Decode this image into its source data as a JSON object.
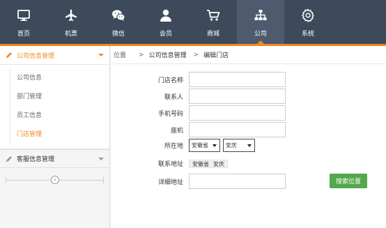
{
  "nav": {
    "items": [
      {
        "label": "首页",
        "icon": "monitor-icon"
      },
      {
        "label": "机票",
        "icon": "airplane-icon"
      },
      {
        "label": "微信",
        "icon": "wechat-icon"
      },
      {
        "label": "会员",
        "icon": "user-icon"
      },
      {
        "label": "商城",
        "icon": "cart-icon"
      },
      {
        "label": "公司",
        "icon": "org-chart-icon"
      },
      {
        "label": "系统",
        "icon": "gear-icon"
      }
    ],
    "active_index": 5,
    "accent_color": "#f08a1c",
    "bar_color": "#3d4a5c"
  },
  "sidebar": {
    "groups": [
      {
        "label": "公司信息管理",
        "expanded": true,
        "items": [
          {
            "label": "公司信息"
          },
          {
            "label": "部门管理"
          },
          {
            "label": "员工信息"
          },
          {
            "label": "门店管理"
          }
        ],
        "current_index": 3
      },
      {
        "label": "客服信息管理",
        "expanded": false
      }
    ]
  },
  "breadcrumb": {
    "location_label": "位置",
    "crumbs": [
      "公司信息管理",
      "编辑门店"
    ]
  },
  "form": {
    "store_name_label": "门店名称",
    "contact_label": "联系人",
    "mobile_label": "手机号码",
    "landline_label": "座机",
    "location_label": "所在地",
    "province_value": "安徽省",
    "city_value": "安庆",
    "contact_address_label": "联系地址",
    "contact_address_province": "安徽省",
    "contact_address_city": "安庆",
    "detail_address_label": "详细地址",
    "search_button": "搜索位置",
    "search_button_color": "#52a84b"
  }
}
